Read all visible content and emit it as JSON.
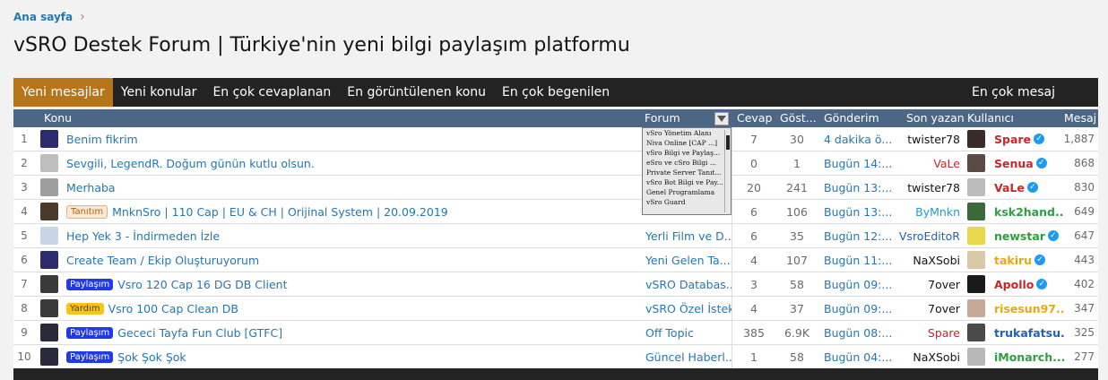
{
  "breadcrumb": {
    "home": "Ana sayfa",
    "chevron": "›"
  },
  "page_title": "vSRO Destek Forum | Türkiye'nin yeni bilgi paylaşım platformu",
  "tabs": [
    "Yeni mesajlar",
    "Yeni konular",
    "En çok cevaplanan",
    "En görüntülenen konu",
    "En çok begenilen"
  ],
  "tab_right": "En çok mesaj",
  "columns": {
    "konu": "Konu",
    "forum": "Forum",
    "cevap": "Cevap",
    "gost": "Göst...",
    "gonderim": "Gönderim",
    "son_yazan": "Son yazan",
    "kullanici": "Kullanıcı",
    "mesaj": "Mesaj"
  },
  "forum_dropdown": [
    "vSro Yönetim Alanı",
    "Niva Online [CAP ...]",
    "vSro Bilgi ve Paylaş...",
    "eSro ve cSro Bilgi ...",
    "Private Server Tanıt...",
    "vSro Bot Bilgi ve Pay...",
    "Genel Programlama",
    "vSro Guard"
  ],
  "rows": [
    {
      "num": "1",
      "badge": "",
      "badge_type": "",
      "title": "Benim fikrim",
      "forum": "",
      "cevap": "7",
      "gost": "30",
      "gonderim": "4 dakika ö...",
      "son_yazan": "twister78",
      "son_color": "#141414",
      "kullanici": "Spare",
      "k_color": "#c62828",
      "verified": true,
      "mesaj": "1,887",
      "av": "#2b2b6e",
      "uav": "#3b2a2a"
    },
    {
      "num": "2",
      "badge": "",
      "badge_type": "",
      "title": "Sevgili, LegendR. Doğum günün kutlu olsun.",
      "forum": "",
      "cevap": "0",
      "gost": "1",
      "gonderim": "Bugün 14:...",
      "son_yazan": "VaLe",
      "son_color": "#c62828",
      "kullanici": "Senua",
      "k_color": "#c62828",
      "verified": true,
      "mesaj": "868",
      "av": "#bdbdbd",
      "uav": "#5a4a44"
    },
    {
      "num": "3",
      "badge": "",
      "badge_type": "",
      "title": "Merhaba",
      "forum": "",
      "cevap": "20",
      "gost": "241",
      "gonderim": "Bugün 13:...",
      "son_yazan": "twister78",
      "son_color": "#141414",
      "kullanici": "VaLe",
      "k_color": "#c62828",
      "verified": true,
      "mesaj": "830",
      "av": "#9e9e9e",
      "uav": "#bcbcbc"
    },
    {
      "num": "4",
      "badge": "Tanıtım",
      "badge_type": "tanitim",
      "title": "MnknSro | 110 Cap | EU & CH | Orijinal System | 20.09.2019",
      "forum": "",
      "cevap": "6",
      "gost": "106",
      "gonderim": "Bugün 13:...",
      "son_yazan": "ByMnkn",
      "son_color": "#1e9be0",
      "kullanici": "ksk2hand...",
      "k_color": "#2e9e3e",
      "verified": false,
      "mesaj": "649",
      "av": "#4a3a2a",
      "uav": "#3a6a3a"
    },
    {
      "num": "5",
      "badge": "",
      "badge_type": "",
      "title": "Hep Yek 3 - İndirmeden İzle",
      "forum": "Yerli Film ve D...",
      "cevap": "6",
      "gost": "35",
      "gonderim": "Bugün 12:...",
      "son_yazan": "VsroEditoR",
      "son_color": "#1e5fc2",
      "kullanici": "newstar",
      "k_color": "#2e9e3e",
      "verified": true,
      "mesaj": "647",
      "av": "#c8d4e8",
      "uav": "#e8d84a"
    },
    {
      "num": "6",
      "badge": "",
      "badge_type": "",
      "title": "Create Team / Ekip Oluşturuyorum",
      "forum": "Yeni Gelen Ta...",
      "cevap": "4",
      "gost": "107",
      "gonderim": "Bugün 11:...",
      "son_yazan": "NaXSobi",
      "son_color": "#141414",
      "kullanici": "takiru",
      "k_color": "#e6a817",
      "verified": true,
      "mesaj": "443",
      "av": "#2b2b6e",
      "uav": "#d8c8a8"
    },
    {
      "num": "7",
      "badge": "Paylaşım",
      "badge_type": "paylasim",
      "title": "Vsro 120 Cap 16 DG DB Client",
      "forum": "vSRO Databas...",
      "cevap": "3",
      "gost": "58",
      "gonderim": "Bugün 09:...",
      "son_yazan": "7over",
      "son_color": "#141414",
      "kullanici": "Apollo",
      "k_color": "#c62828",
      "verified": true,
      "mesaj": "402",
      "av": "#3a3a3a",
      "uav": "#1a1a1a"
    },
    {
      "num": "8",
      "badge": "Yardım",
      "badge_type": "yardim",
      "title": "Vsro 100 Cap Clean DB",
      "forum": "vSRO Özel İstek",
      "cevap": "4",
      "gost": "37",
      "gonderim": "Bugün 09:...",
      "son_yazan": "7over",
      "son_color": "#141414",
      "kullanici": "risesun97...",
      "k_color": "#e6a817",
      "verified": false,
      "mesaj": "347",
      "av": "#3a3a3a",
      "uav": "#c8a898"
    },
    {
      "num": "9",
      "badge": "Paylaşım",
      "badge_type": "paylasim",
      "title": "Gececi Tayfa Fun Club [GTFC]",
      "forum": "Off Topic",
      "cevap": "385",
      "gost": "6.9K",
      "gonderim": "Bugün 08:...",
      "son_yazan": "Spare",
      "son_color": "#c62828",
      "kullanici": "trukafatsu...",
      "k_color": "#1e5fc2",
      "verified": false,
      "mesaj": "325",
      "av": "#2a2a3a",
      "uav": "#4a4a4a"
    },
    {
      "num": "10",
      "badge": "Paylaşım",
      "badge_type": "paylasim",
      "title": "Şok Şok Şok",
      "forum": "Güncel Haberl...",
      "cevap": "1",
      "gost": "58",
      "gonderim": "Bugün 04:...",
      "son_yazan": "NaXSobi",
      "son_color": "#141414",
      "kullanici": "iMonarch...",
      "k_color": "#2e9e3e",
      "verified": false,
      "mesaj": "277",
      "av": "#2a2a3a",
      "uav": "#b8b8b8"
    }
  ]
}
